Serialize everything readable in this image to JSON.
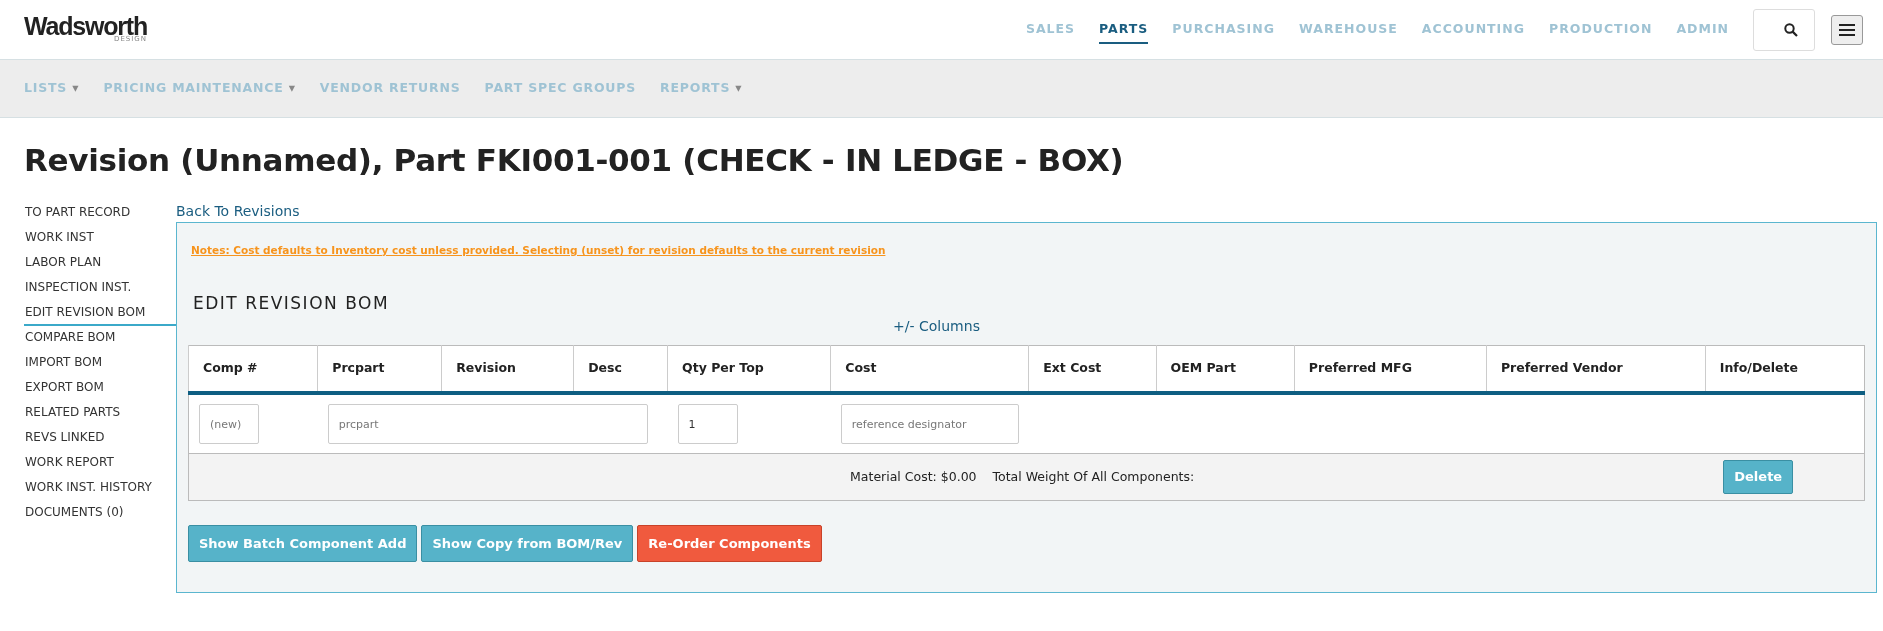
{
  "logo": {
    "name": "Wadsworth",
    "tagline": "DESIGN"
  },
  "top_nav": [
    {
      "label": "SALES",
      "selected": false
    },
    {
      "label": "PARTS",
      "selected": true
    },
    {
      "label": "PURCHASING",
      "selected": false
    },
    {
      "label": "WAREHOUSE",
      "selected": false
    },
    {
      "label": "ACCOUNTING",
      "selected": false
    },
    {
      "label": "PRODUCTION",
      "selected": false
    },
    {
      "label": "ADMIN",
      "selected": false
    }
  ],
  "sub_nav": [
    {
      "label": "LISTS",
      "caret": "▾"
    },
    {
      "label": "PRICING MAINTENANCE",
      "caret": "▾"
    },
    {
      "label": "VENDOR RETURNS"
    },
    {
      "label": "PART SPEC GROUPS"
    },
    {
      "label": "REPORTS",
      "caret": "▾"
    }
  ],
  "page_title": "Revision (Unnamed), Part FKI001-001 (CHECK - IN LEDGE - BOX)",
  "sidebar": [
    {
      "label": "TO PART RECORD",
      "selected": false
    },
    {
      "label": "WORK INST",
      "selected": false
    },
    {
      "label": "LABOR PLAN",
      "selected": false
    },
    {
      "label": "INSPECTION INST.",
      "selected": false
    },
    {
      "label": "EDIT REVISION BOM",
      "selected": true
    },
    {
      "label": "COMPARE BOM",
      "selected": false
    },
    {
      "label": "IMPORT BOM",
      "selected": false
    },
    {
      "label": "EXPORT BOM",
      "selected": false
    },
    {
      "label": "RELATED PARTS",
      "selected": false
    },
    {
      "label": "REVS LINKED",
      "selected": false
    },
    {
      "label": "WORK REPORT",
      "selected": false
    },
    {
      "label": "WORK INST. HISTORY",
      "selected": false
    },
    {
      "label": "DOCUMENTS (0)",
      "selected": false
    }
  ],
  "back_link": "Back To Revisions",
  "notes": "Notes: Cost defaults to Inventory cost unless provided. Selecting (unset) for revision defaults to the current revision",
  "section_title": "EDIT REVISION BOM",
  "columns_toggle": "+/- Columns",
  "table": {
    "columns": [
      "Comp #",
      "Prcpart",
      "Revision",
      "Desc",
      "Qty Per Top",
      "Cost",
      "Ext Cost",
      "OEM Part",
      "Preferred MFG",
      "Preferred Vendor",
      "Info/Delete"
    ],
    "new_row": {
      "comp_placeholder": "(new)",
      "prcpart_placeholder": "prcpart",
      "qty_value": "1",
      "cost_placeholder": "reference designator"
    },
    "footer": {
      "material_cost": "Material Cost: $0.00",
      "total_weight": "Total Weight Of All Components:",
      "delete_button": "Delete"
    }
  },
  "buttons": [
    {
      "label": "Show Batch Component Add",
      "kind": "info"
    },
    {
      "label": "Show Copy from BOM/Rev",
      "kind": "info"
    },
    {
      "label": "Re-Order Components",
      "kind": "danger"
    }
  ]
}
